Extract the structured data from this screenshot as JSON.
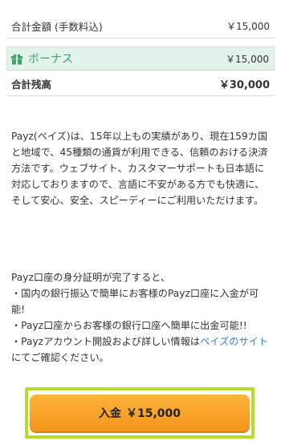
{
  "summary": {
    "total_label": "合計金額 (手数料込)",
    "total_amount": "￥15,000",
    "bonus_label": "ボーナス",
    "bonus_amount": "￥15,000",
    "grand_label": "合計残高",
    "grand_amount": "￥30,000"
  },
  "description": "Payz(ペイズ)は、15年以上もの実績があり、現在159カ国と地域で、45種類の通貨が利用できる、信頼のおける決済方法です。ウェブサイト、カスタマーサポートも日本語に対応しておりますので、言語に不安がある方でも快適に、そして安心、安全、スピーディーにご利用いただけます。",
  "info": {
    "intro": "Payz口座の身分証明が完了すると、",
    "bullet1": "・国内の銀行振込で簡単にお客様のPayz口座に入金が可能!",
    "bullet2": "・Payz口座からお客様の銀行口座へ簡単に出金可能!!",
    "bullet3_prefix": "・Payzアカウント開設および詳しい情報は",
    "bullet3_link": "ペイズのサイト",
    "bullet3_suffix": "にてご確認ください。"
  },
  "cta": {
    "label": "入金",
    "amount": "￥15,000"
  },
  "colors": {
    "bonus_green": "#3aa56a",
    "cta_orange": "#f4941c",
    "highlight_frame": "#b6dc2c",
    "link_blue": "#2f7fd8"
  },
  "icons": {
    "bonus": "gift-icon"
  }
}
